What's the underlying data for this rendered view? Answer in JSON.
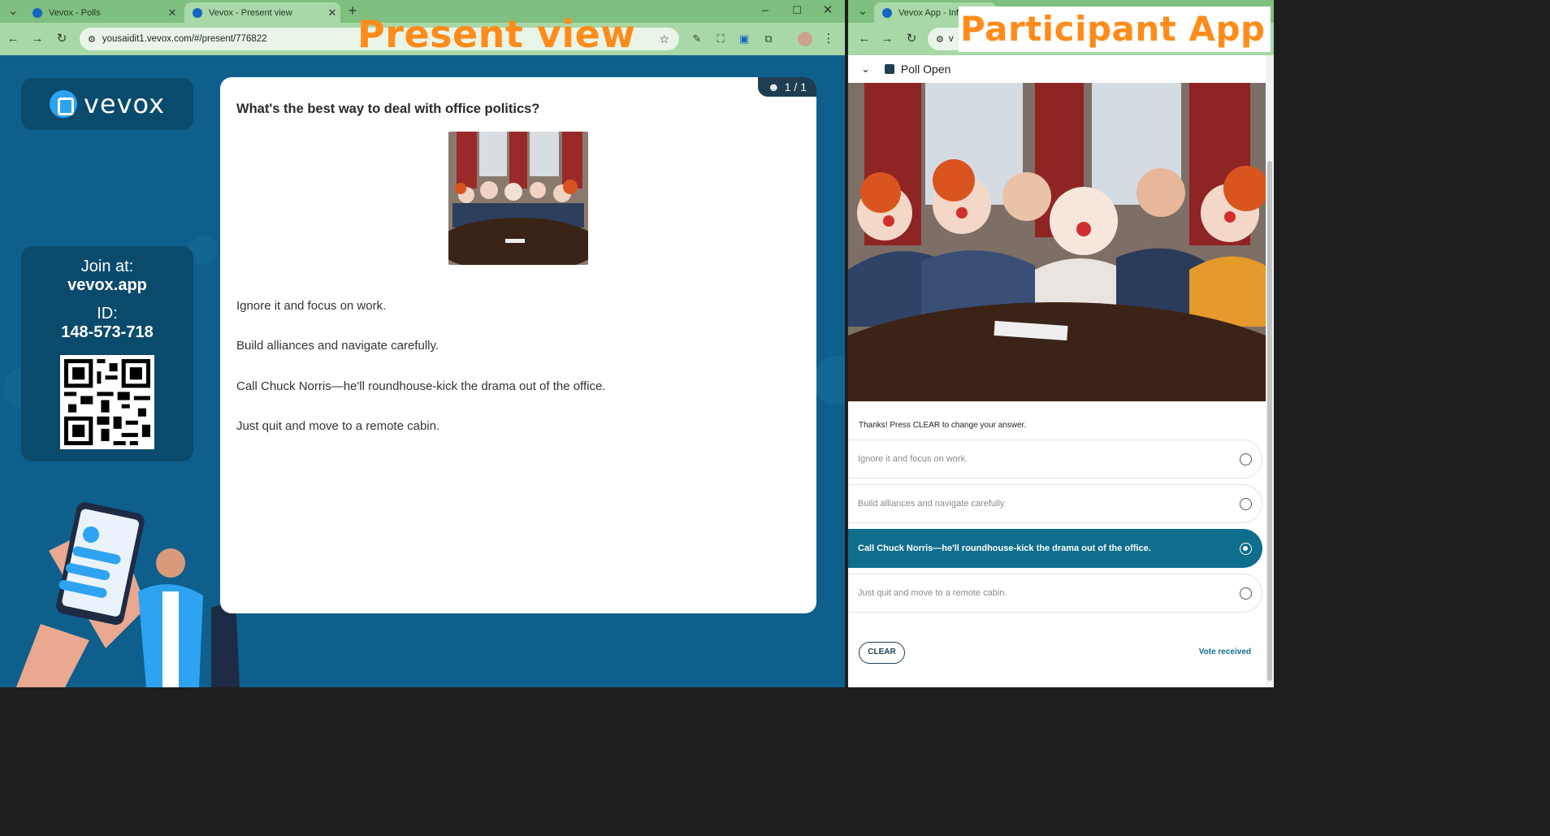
{
  "left_window": {
    "tabs": [
      {
        "title": "Vevox - Polls",
        "active": false
      },
      {
        "title": "Vevox - Present view",
        "active": true
      }
    ],
    "url": "yousaidit1.vevox.com/#/present/776822",
    "overlay_label": "Present view"
  },
  "present": {
    "logo_text": "vevox",
    "join_at_label": "Join at:",
    "join_url": "vevox.app",
    "id_label": "ID:",
    "session_id": "148-573-718",
    "counter": "1 / 1",
    "question": "What's the best way to deal with office politics?",
    "options": [
      "Ignore it and focus on work.",
      "Build alliances and navigate carefully.",
      "Call Chuck Norris—he'll roundhouse-kick the drama out of the office.",
      "Just quit and move to a remote cabin."
    ]
  },
  "right_window": {
    "tab_title": "Vevox App - Info",
    "url_fragment": "v",
    "overlay_label": "Participant App"
  },
  "participant": {
    "status": "Poll Open",
    "thanks_text": "Thanks! Press CLEAR to change your answer.",
    "options": [
      {
        "label": "Ignore it and focus on work.",
        "selected": false
      },
      {
        "label": "Build alliances and navigate carefully.",
        "selected": false
      },
      {
        "label": "Call Chuck Norris—he'll roundhouse-kick the drama out of the office.",
        "selected": true
      },
      {
        "label": "Just quit and move to a remote cabin.",
        "selected": false
      }
    ],
    "clear_label": "CLEAR",
    "vote_status": "Vote received"
  },
  "colors": {
    "accent": "#0f6e8c",
    "present_bg": "#0f5f8c",
    "overlay_text": "#ff8c1a",
    "chrome_green": "#7fbf7f"
  }
}
